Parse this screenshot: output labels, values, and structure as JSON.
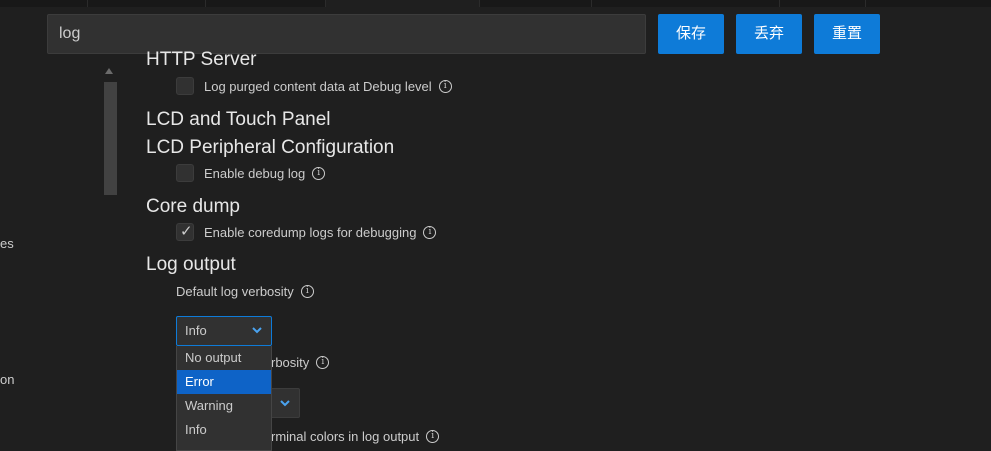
{
  "search": {
    "value": "log"
  },
  "toolbar": {
    "save_label": "保存",
    "discard_label": "丢弃",
    "reset_label": "重置"
  },
  "sidebar_fragments": [
    "es",
    "on"
  ],
  "sections": {
    "partial_heading": "HTTP Server",
    "http_purge": {
      "label": "Log purged content data at Debug level",
      "checked": false
    },
    "lcd_heading": "LCD and Touch Panel",
    "lcd_peripheral_heading": "LCD Peripheral Configuration",
    "lcd_debug": {
      "label": "Enable debug log",
      "checked": false
    },
    "core_dump_heading": "Core dump",
    "coredump_logs": {
      "label": "Enable coredump logs for debugging",
      "checked": true
    },
    "log_output_heading": "Log output",
    "default_verbosity_label": "Default log verbosity",
    "max_verbosity_label_tail": "rbosity",
    "terminal_colors_label_tail": "rminal colors in log output"
  },
  "verbosity_select": {
    "value": "Info",
    "options": [
      "No output",
      "Error",
      "Warning",
      "Info"
    ],
    "highlighted": "Error"
  },
  "colors": {
    "accent": "#0e7bd8",
    "highlight": "#0e63c7",
    "background": "#1f1f1f"
  }
}
